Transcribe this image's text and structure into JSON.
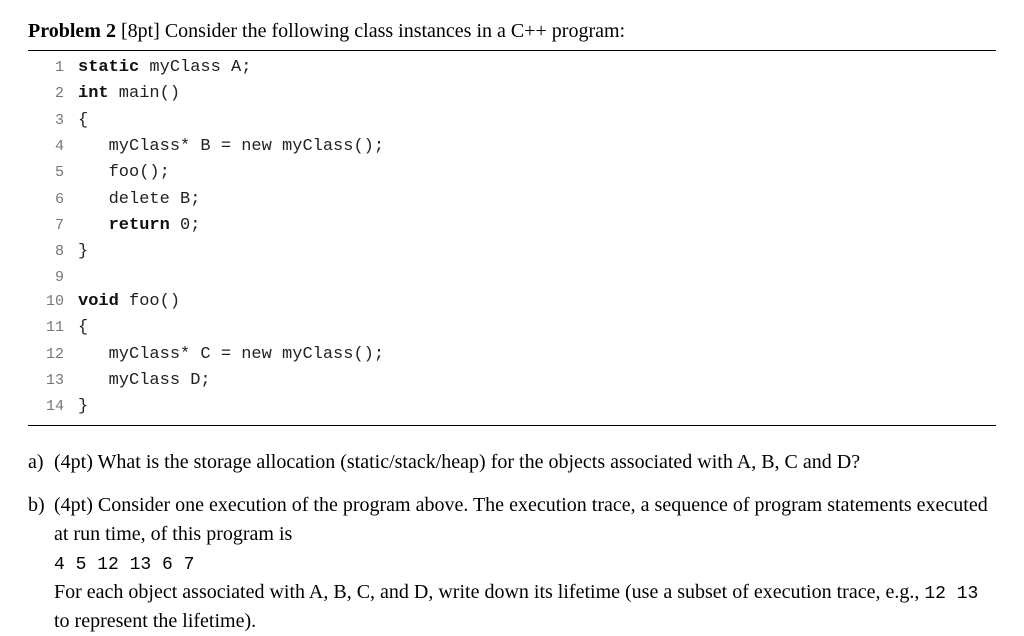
{
  "title": {
    "heading": "Problem 2",
    "points": "[8pt]",
    "text": "Consider the following class instances in a C++ program:"
  },
  "code": {
    "lines": [
      {
        "n": "1",
        "pre": "",
        "kw": "static",
        "rest": " myClass A;"
      },
      {
        "n": "2",
        "pre": "",
        "kw": "int",
        "rest": " main()"
      },
      {
        "n": "3",
        "pre": "",
        "kw": "",
        "rest": "{"
      },
      {
        "n": "4",
        "pre": "   ",
        "kw": "",
        "rest": "myClass* B = new myClass();"
      },
      {
        "n": "5",
        "pre": "   ",
        "kw": "",
        "rest": "foo();"
      },
      {
        "n": "6",
        "pre": "   ",
        "kw": "",
        "rest": "delete B;"
      },
      {
        "n": "7",
        "pre": "   ",
        "kw": "return",
        "rest": " 0;"
      },
      {
        "n": "8",
        "pre": "",
        "kw": "",
        "rest": "}"
      },
      {
        "n": "9",
        "pre": "",
        "kw": "",
        "rest": ""
      },
      {
        "n": "10",
        "pre": "",
        "kw": "void",
        "rest": " foo()"
      },
      {
        "n": "11",
        "pre": "",
        "kw": "",
        "rest": "{"
      },
      {
        "n": "12",
        "pre": "   ",
        "kw": "",
        "rest": "myClass* C = new myClass();"
      },
      {
        "n": "13",
        "pre": "   ",
        "kw": "",
        "rest": "myClass D;"
      },
      {
        "n": "14",
        "pre": "",
        "kw": "",
        "rest": "}"
      }
    ]
  },
  "qa": {
    "a": {
      "label": "a)",
      "points": "(4pt)",
      "text": "What is the storage allocation (static/stack/heap) for the objects associated with A, B, C and D?"
    },
    "b": {
      "label": "b)",
      "points": "(4pt)",
      "text1": "Consider one execution of the program above. The execution trace, a sequence of program statements executed at run time, of this program is",
      "trace": "4 5 12 13 6 7",
      "text2a": "For each object associated with A, B, C, and D, write down its lifetime (use a subset of execution trace, e.g., ",
      "example": "12 13",
      "text2b": " to represent the lifetime)."
    }
  }
}
